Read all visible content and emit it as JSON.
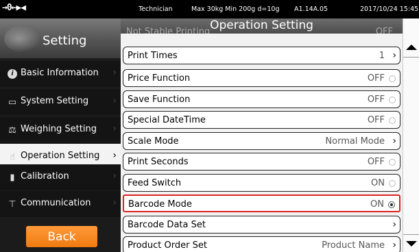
{
  "status_bar": {
    "indicator": "→0←▶◀",
    "role": "Technician",
    "capacity": "Max 30kg  Min 200g  d=10g",
    "version": "A1.14A.05",
    "datetime": "2017/10/24 15:45"
  },
  "sidebar": {
    "title": "Setting",
    "items": [
      {
        "label": "Basic Information",
        "icon": "info-icon",
        "glyph": "i",
        "active": false
      },
      {
        "label": "System Setting",
        "icon": "monitor-icon",
        "glyph": "▭",
        "active": false
      },
      {
        "label": "Weighing Setting",
        "icon": "scale-icon",
        "glyph": "⚖",
        "active": false
      },
      {
        "label": "Operation Setting",
        "icon": "hand-pointer-icon",
        "glyph": "☝",
        "active": true
      },
      {
        "label": "Calibration",
        "icon": "weight-icon",
        "glyph": "▮",
        "active": false
      },
      {
        "label": "Communication",
        "icon": "network-icon",
        "glyph": "⊤",
        "active": false
      }
    ],
    "back_label": "Back"
  },
  "main": {
    "title": "Operation Setting",
    "partial_row": {
      "label": "Not Stable Printing",
      "value": "OFF"
    },
    "rows": [
      {
        "label": "Print Times",
        "value": "1",
        "control": "chevron"
      },
      {
        "label": "Price Function",
        "value": "OFF",
        "control": "radio-off"
      },
      {
        "label": "Save Function",
        "value": "OFF",
        "control": "radio-off"
      },
      {
        "label": "Special DateTime",
        "value": "OFF",
        "control": "radio-off"
      },
      {
        "label": "Scale Mode",
        "value": "Normal Mode",
        "control": "chevron"
      },
      {
        "label": "Print Seconds",
        "value": "OFF",
        "control": "radio-off"
      },
      {
        "label": "Feed Switch",
        "value": "ON",
        "control": "radio-off"
      },
      {
        "label": "Barcode Mode",
        "value": "ON",
        "control": "radio-on",
        "highlighted": true
      },
      {
        "label": "Barcode Data Set",
        "value": "",
        "control": "chevron"
      },
      {
        "label": "Product Order Set",
        "value": "Product Name",
        "control": "chevron"
      }
    ]
  },
  "colors": {
    "back_button": "#f58a1f",
    "highlight_border": "#e02020",
    "active_sidebar_bg": "#f3f3f3"
  }
}
